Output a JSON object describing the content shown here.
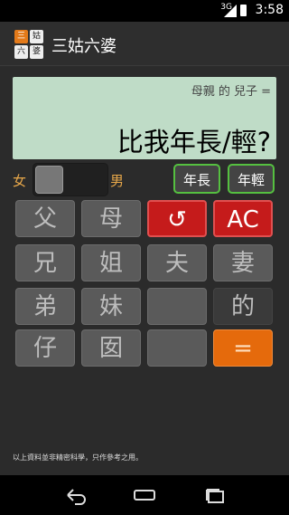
{
  "status": {
    "network": "3G",
    "time": "3:58"
  },
  "app": {
    "title": "三姑六婆",
    "logo_chars": [
      "三",
      "姑",
      "六",
      "婆"
    ]
  },
  "display": {
    "expression": "母親 的 兒子 =",
    "result": "比我年長/輕?"
  },
  "gender": {
    "female": "女",
    "male": "男"
  },
  "age_buttons": {
    "older": "年長",
    "younger": "年輕"
  },
  "keys": {
    "row1": [
      "父",
      "母",
      "↺",
      "AC"
    ],
    "row2": [
      "兄",
      "姐",
      "夫",
      "妻"
    ],
    "row3": [
      "弟",
      "妹",
      "",
      "的"
    ],
    "row4": [
      "仔",
      "囡",
      "",
      "="
    ]
  },
  "footer_note": "以上資料並非精密科學，只作參考之用。",
  "colors": {
    "accent_orange": "#e56a0c",
    "clear_red": "#c51b1b",
    "display_bg": "#bfdcc7",
    "age_border": "#55c040"
  }
}
